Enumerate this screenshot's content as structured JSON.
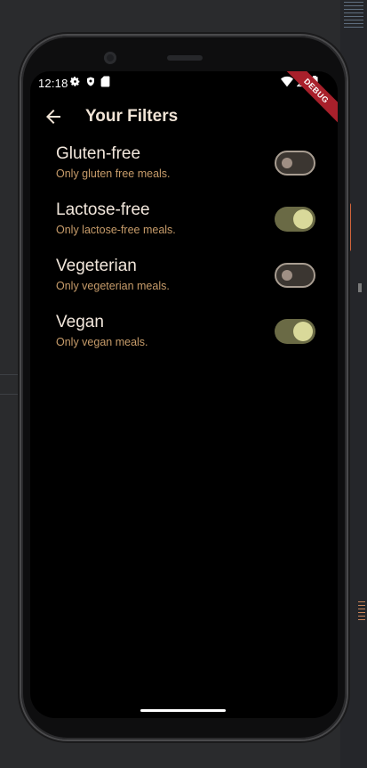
{
  "status_bar": {
    "time": "12:18",
    "left_icons": [
      "gear-icon",
      "shield-icon",
      "sd-card-icon"
    ],
    "right_icons": [
      "wifi-icon",
      "signal-icon",
      "battery-icon"
    ]
  },
  "debug_label": "DEBUG",
  "app_bar": {
    "back_icon": "arrow-back-icon",
    "title": "Your Filters"
  },
  "filters": [
    {
      "title": "Gluten-free",
      "subtitle": "Only gluten free meals.",
      "enabled": false
    },
    {
      "title": "Lactose-free",
      "subtitle": "Only lactose-free meals.",
      "enabled": true
    },
    {
      "title": "Vegeterian",
      "subtitle": "Only vegeterian meals.",
      "enabled": false
    },
    {
      "title": "Vegan",
      "subtitle": "Only vegan meals.",
      "enabled": true
    }
  ],
  "colors": {
    "title": "#f1e4d6",
    "subtitle": "#c79c6a",
    "switch_on_track": "#6a6a45",
    "switch_on_thumb": "#d9d99a",
    "switch_off_track": "#3b3631",
    "switch_off_thumb": "#9f8f84",
    "debug_banner": "#a8202b"
  }
}
